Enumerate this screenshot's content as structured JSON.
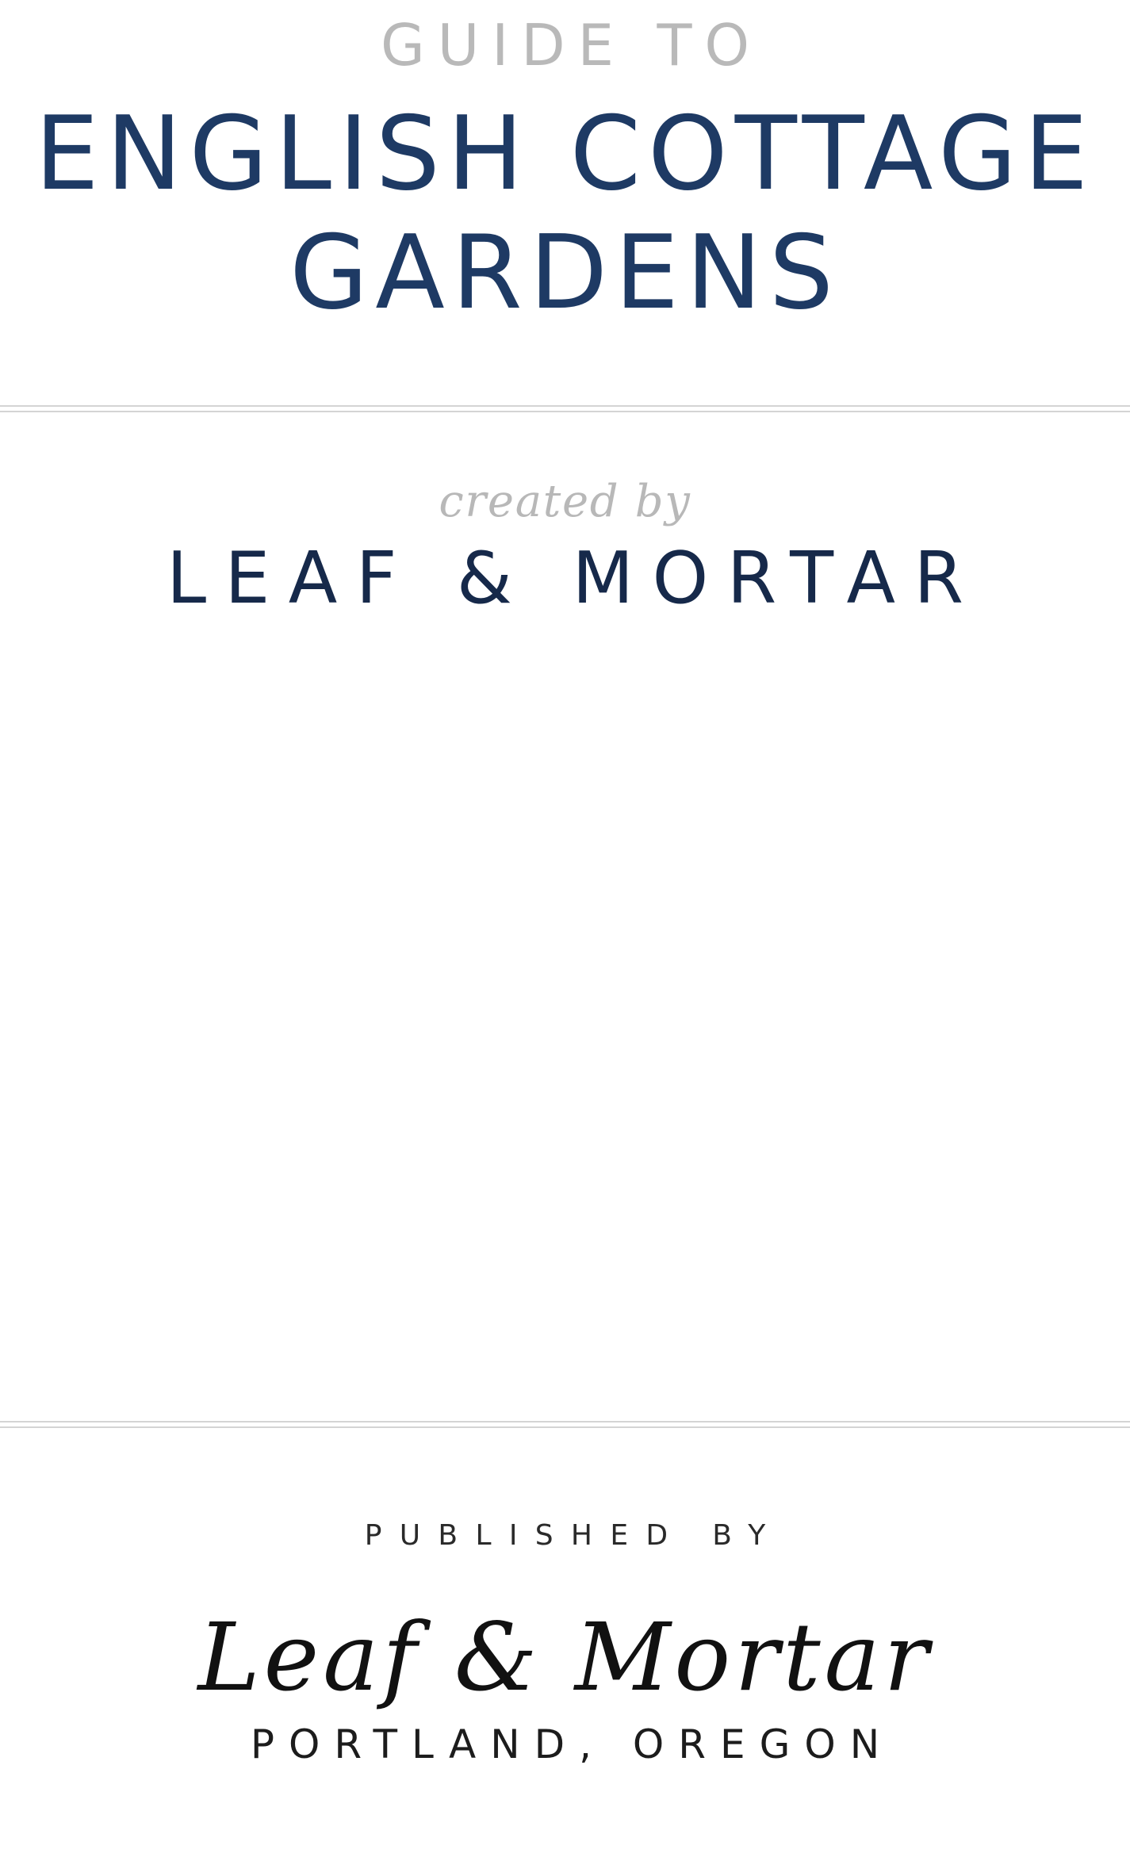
{
  "header": {
    "kicker": "GUIDE TO",
    "title_line1": "ENGLISH COTTAGE",
    "title_line2": "GARDENS"
  },
  "credit": {
    "intro": "created by",
    "creator": "LEAF & MORTAR"
  },
  "publisher": {
    "label": "PUBLISHED BY",
    "name": "Leaf & Mortar",
    "location": "PORTLAND, OREGON"
  },
  "colors": {
    "title": "#1e3a64",
    "kicker": "#b9b9b9",
    "creator": "#16294a",
    "rule": "#d4d4d4"
  }
}
